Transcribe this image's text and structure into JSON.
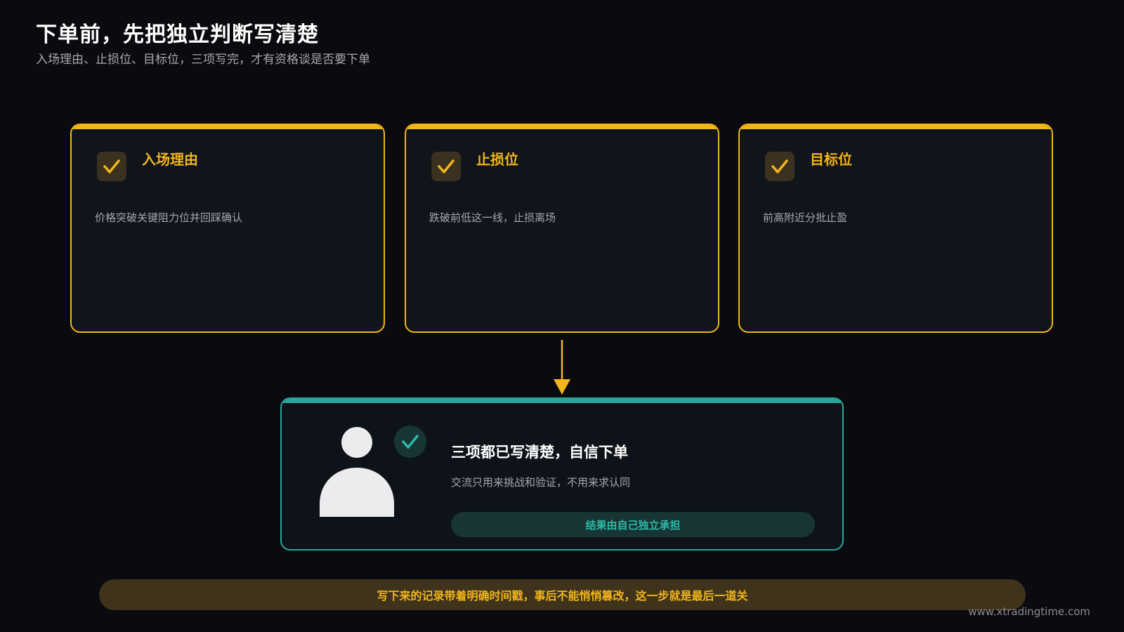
{
  "header": {
    "title": "下单前，先把独立判断写清楚",
    "subtitle": "入场理由、止损位、目标位，三项写完，才有资格谈是否要下单"
  },
  "cards": [
    {
      "title": "入场理由",
      "desc": "价格突破关键阻力位并回踩确认",
      "icon": "check-icon"
    },
    {
      "title": "止损位",
      "desc": "跌破前低这一线，止损离场",
      "icon": "check-icon"
    },
    {
      "title": "目标位",
      "desc": "前高附近分批止盈",
      "icon": "check-icon"
    }
  ],
  "result": {
    "title": "三项都已写清楚，自信下单",
    "desc": "交流只用来挑战和验证，不用来求认同",
    "pill": "结果由自己独立承担",
    "icons": [
      "person-icon",
      "check-circle-icon"
    ]
  },
  "banner": {
    "text": "写下来的记录带着明确时间戳，事后不能悄悄篡改，这一步就是最后一道关"
  },
  "footer": {
    "watermark": "www.xtradingtime.com"
  },
  "colors": {
    "background": "#0a0a0f",
    "accent_gold": "#f2b51a",
    "accent_teal": "#2aa79a",
    "card_bg": "#10141b",
    "muted_text": "#a8a8ae"
  }
}
